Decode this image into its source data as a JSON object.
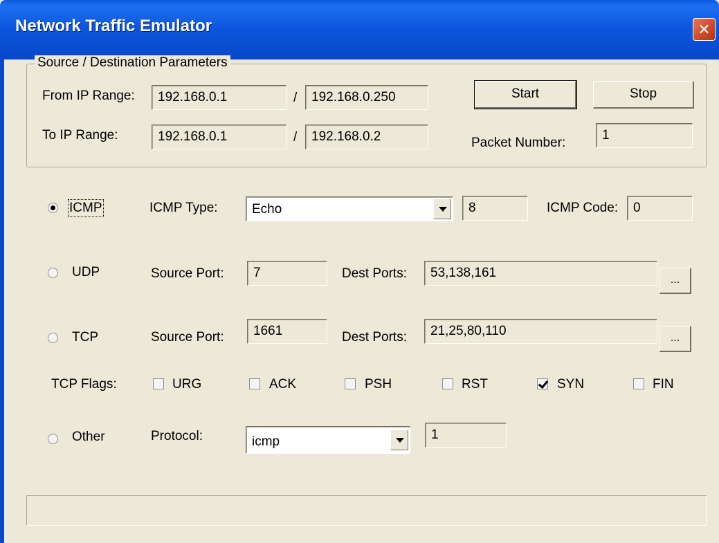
{
  "window": {
    "title": "Network Traffic Emulator",
    "close_glyph": "✕"
  },
  "source_destination": {
    "legend": "Source / Destination Parameters",
    "from_label": "From IP Range:",
    "from_start": "192.168.0.1",
    "from_end": "192.168.0.250",
    "to_label": "To IP Range:",
    "to_start": "192.168.0.1",
    "to_end": "192.168.0.2",
    "separator": "/",
    "start_button": "Start",
    "stop_button": "Stop",
    "packet_label": "Packet Number:",
    "packet_number": "1"
  },
  "icmp": {
    "radio_label": "ICMP",
    "selected": true,
    "type_label": "ICMP Type:",
    "type_value": "Echo",
    "type_number": "8",
    "code_label": "ICMP Code:",
    "code_value": "0"
  },
  "udp": {
    "radio_label": "UDP",
    "selected": false,
    "source_port_label": "Source Port:",
    "source_port": "7",
    "dest_ports_label": "Dest Ports:",
    "dest_ports": "53,138,161",
    "browse_label": "..."
  },
  "tcp": {
    "radio_label": "TCP",
    "selected": false,
    "source_port_label": "Source Port:",
    "source_port": "1661",
    "dest_ports_label": "Dest Ports:",
    "dest_ports": "21,25,80,110",
    "browse_label": "..."
  },
  "tcp_flags": {
    "label": "TCP Flags:",
    "flags": [
      {
        "name": "URG",
        "checked": false
      },
      {
        "name": "ACK",
        "checked": false
      },
      {
        "name": "PSH",
        "checked": false
      },
      {
        "name": "RST",
        "checked": false
      },
      {
        "name": "SYN",
        "checked": true
      },
      {
        "name": "FIN",
        "checked": false
      }
    ]
  },
  "other": {
    "radio_label": "Other",
    "selected": false,
    "protocol_label": "Protocol:",
    "protocol_value": "icmp",
    "protocol_number": "1"
  },
  "status": {
    "text": ""
  }
}
